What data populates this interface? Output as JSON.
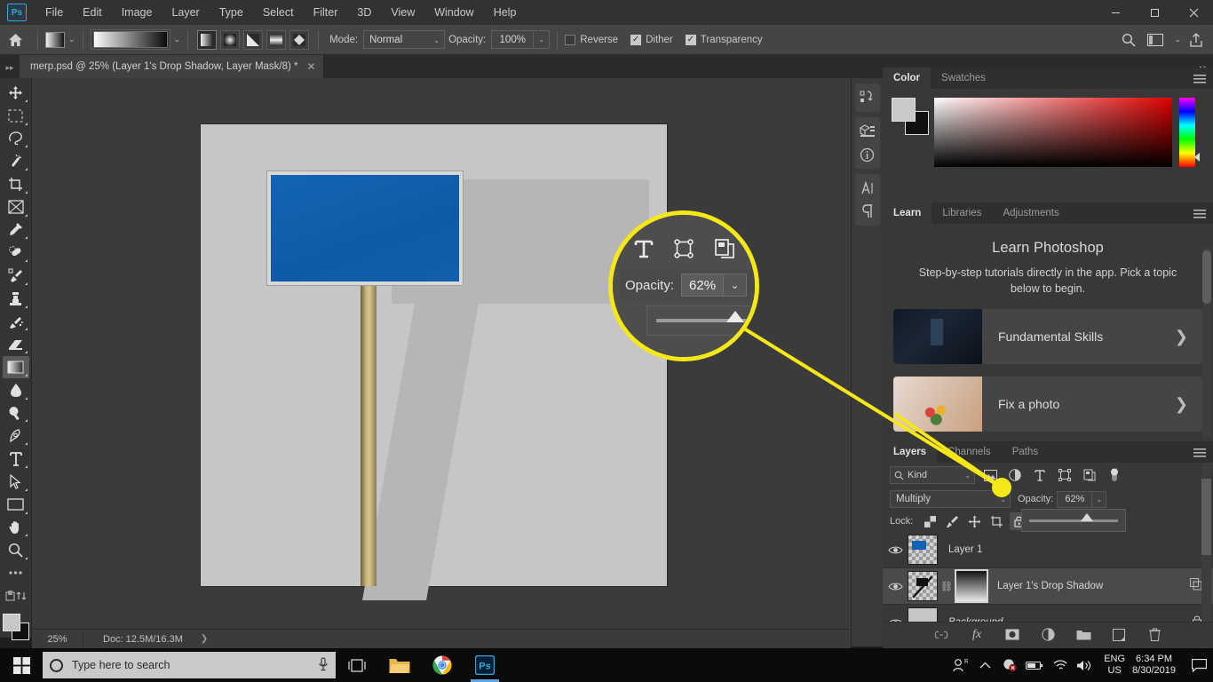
{
  "app": {
    "logo": "Ps",
    "menus": [
      "File",
      "Edit",
      "Image",
      "Layer",
      "Type",
      "Select",
      "Filter",
      "3D",
      "View",
      "Window",
      "Help"
    ],
    "window_controls": {
      "minimize": "—",
      "maximize": "❐",
      "close": "✕"
    }
  },
  "options_bar": {
    "home_icon": "home-icon",
    "gradient_preset_icon": "gradient-swatch",
    "gradient_picker_icon": "gradient-preview",
    "gradient_types": [
      "linear-gradient-icon",
      "radial-gradient-icon",
      "angle-gradient-icon",
      "reflected-gradient-icon",
      "diamond-gradient-icon"
    ],
    "mode_label": "Mode:",
    "mode_value": "Normal",
    "opacity_label": "Opacity:",
    "opacity_value": "100%",
    "checkboxes": [
      {
        "label": "Reverse",
        "checked": false
      },
      {
        "label": "Dither",
        "checked": true
      },
      {
        "label": "Transparency",
        "checked": true
      }
    ],
    "right_icons": [
      "search-icon",
      "workspace-icon",
      "chevron-down-icon",
      "share-icon"
    ]
  },
  "document_tab": {
    "title": "merp.psd @ 25% (Layer 1's Drop Shadow, Layer Mask/8) *",
    "close": "✕",
    "collapse_left": "▸▸",
    "collapse_right": "▸▸"
  },
  "toolbar": {
    "tools": [
      "move-tool",
      "rectangular-marquee-tool",
      "lasso-tool",
      "object-selection-tool",
      "crop-tool",
      "frame-tool",
      "eyedropper-tool",
      "healing-brush-tool",
      "brush-tool",
      "clone-stamp-tool",
      "history-brush-tool",
      "eraser-tool",
      "gradient-tool",
      "blur-tool",
      "dodge-tool",
      "pen-tool",
      "type-tool",
      "path-selection-tool",
      "rectangle-tool",
      "hand-tool",
      "zoom-tool",
      "more-tools",
      "edit-toolbar"
    ],
    "selected_tool": "gradient-tool",
    "foreground_color": "#c7c7c7",
    "background_color": "#111111"
  },
  "canvas": {
    "sign_color": "#1262b4",
    "artboard_color": "#c6c6c6",
    "shadow_color": "#b6b6b6"
  },
  "status_bar": {
    "zoom": "25%",
    "doc": "Doc: 12.5M/16.3M",
    "arrow": "❯"
  },
  "right_rail": {
    "icons": [
      "history-icon",
      "properties-icon",
      "info-icon",
      "character-icon",
      "paragraph-icon"
    ]
  },
  "color_panel": {
    "tabs": [
      {
        "label": "Color",
        "active": true
      },
      {
        "label": "Swatches",
        "active": false
      }
    ],
    "menu_icon": "panel-menu-icon",
    "foreground": "#c9c9c9",
    "background": "#111111"
  },
  "learn_panel": {
    "tabs": [
      {
        "label": "Learn",
        "active": true
      },
      {
        "label": "Libraries",
        "active": false
      },
      {
        "label": "Adjustments",
        "active": false
      }
    ],
    "menu_icon": "panel-menu-icon",
    "heading": "Learn Photoshop",
    "subheading": "Step-by-step tutorials directly in the app. Pick a topic below to begin.",
    "cards": [
      {
        "label": "Fundamental Skills",
        "chevron": "❯",
        "thumb": "dark-room-thumb"
      },
      {
        "label": "Fix a photo",
        "chevron": "❯",
        "thumb": "flowers-thumb"
      }
    ]
  },
  "layers_panel": {
    "tabs": [
      {
        "label": "Layers",
        "active": true
      },
      {
        "label": "Channels",
        "active": false
      },
      {
        "label": "Paths",
        "active": false
      }
    ],
    "menu_icon": "panel-menu-icon",
    "filter": {
      "search_icon": "search-icon",
      "kind_label": "Kind",
      "caret": "⌄",
      "type_icons": [
        "pixel-layer-filter-icon",
        "adjustment-layer-filter-icon",
        "type-layer-filter-icon",
        "shape-layer-filter-icon",
        "smart-object-filter-icon",
        "filter-toggle-icon"
      ]
    },
    "blend_mode": "Multiply",
    "blend_caret": "⌄",
    "opacity_label": "Opacity:",
    "opacity_value": "62%",
    "opacity_caret": "⌄",
    "lock_label": "Lock:",
    "lock_icons": [
      "lock-transparent-pixels-icon",
      "lock-image-pixels-icon",
      "lock-position-icon",
      "lock-artboard-icon",
      "lock-all-icon"
    ],
    "layers": [
      {
        "name": "Layer 1",
        "visible": true,
        "selected": false,
        "thumb": "blue-sign-thumb",
        "has_mask": false,
        "italic": false,
        "locked": false
      },
      {
        "name": "Layer 1's Drop Shadow",
        "visible": true,
        "selected": true,
        "thumb": "shadow-sign-thumb",
        "has_mask": true,
        "link_icon": "link-icon",
        "right_icon": "smart-object-badge-icon",
        "italic": false,
        "locked": false
      },
      {
        "name": "Background",
        "visible": true,
        "selected": false,
        "thumb": "background-thumb",
        "has_mask": false,
        "italic": true,
        "locked": true,
        "right_icon": "lock-icon"
      }
    ],
    "footer_buttons": [
      "link-layers-icon",
      "layer-style-fx-icon",
      "add-mask-icon",
      "new-adjustment-layer-icon",
      "new-group-icon",
      "new-layer-icon",
      "delete-layer-icon"
    ],
    "eye_icon": "eye-icon"
  },
  "magnifier_callout": {
    "accent_color": "#f5e718",
    "top_icons": [
      "type-layer-filter-icon",
      "shape-layer-filter-icon",
      "smart-object-filter-icon",
      "filter-toggle-icon"
    ],
    "opacity_label": "Opacity:",
    "opacity_value": "62%",
    "caret": "⌄"
  },
  "taskbar": {
    "start_icon": "windows-start-icon",
    "search_placeholder": "Type here to search",
    "mic_icon": "microphone-icon",
    "task_view_icon": "task-view-icon",
    "apps": [
      "file-explorer-icon",
      "chrome-icon",
      "photoshop-icon"
    ],
    "tray_icons": [
      "people-icon",
      "show-hidden-icons-chevron",
      "dropbox-icon",
      "battery-icon",
      "wifi-icon",
      "volume-icon"
    ],
    "language": "ENG",
    "region": "US",
    "time": "6:34 PM",
    "date": "8/30/2019",
    "notification_icon": "action-center-icon"
  }
}
